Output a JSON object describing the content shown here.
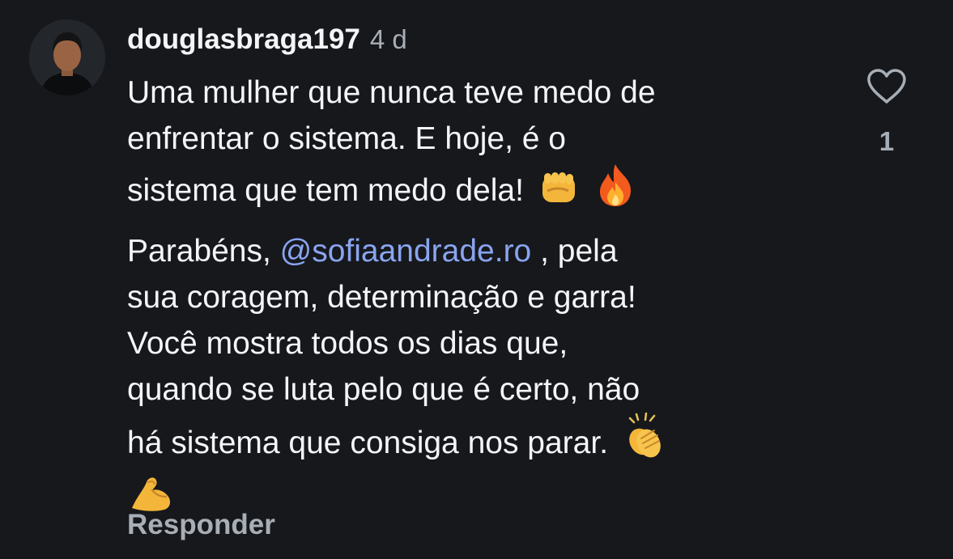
{
  "comment": {
    "username": "douglasbraga197",
    "timestamp": "4 d",
    "paragraphs": [
      {
        "text_lines": [
          "Uma mulher que nunca teve medo de",
          "enfrentar o sistema. E hoje, é o",
          "sistema que tem medo dela!"
        ],
        "emojis": [
          "oncoming-fist-emoji",
          "fire-emoji"
        ]
      },
      {
        "before_mention": "Parabéns,",
        "mention": "@sofiaandrade.ro",
        "after_mention": ", pela",
        "text_lines": [
          "sua coragem, determinação e garra!",
          "Você mostra todos os dias que,",
          "quando se luta pelo que é certo, não",
          "há sistema que consiga nos parar."
        ],
        "emojis": [
          "clapping-hands-emoji",
          "flexed-biceps-emoji"
        ]
      }
    ],
    "reply_label": "Responder",
    "like_count": "1",
    "like_icon": "heart-outline-icon",
    "colors": {
      "background": "#16181c",
      "text": "#f3f5f7",
      "secondary": "#a8aeb5",
      "mention": "#8aa4f0"
    }
  }
}
